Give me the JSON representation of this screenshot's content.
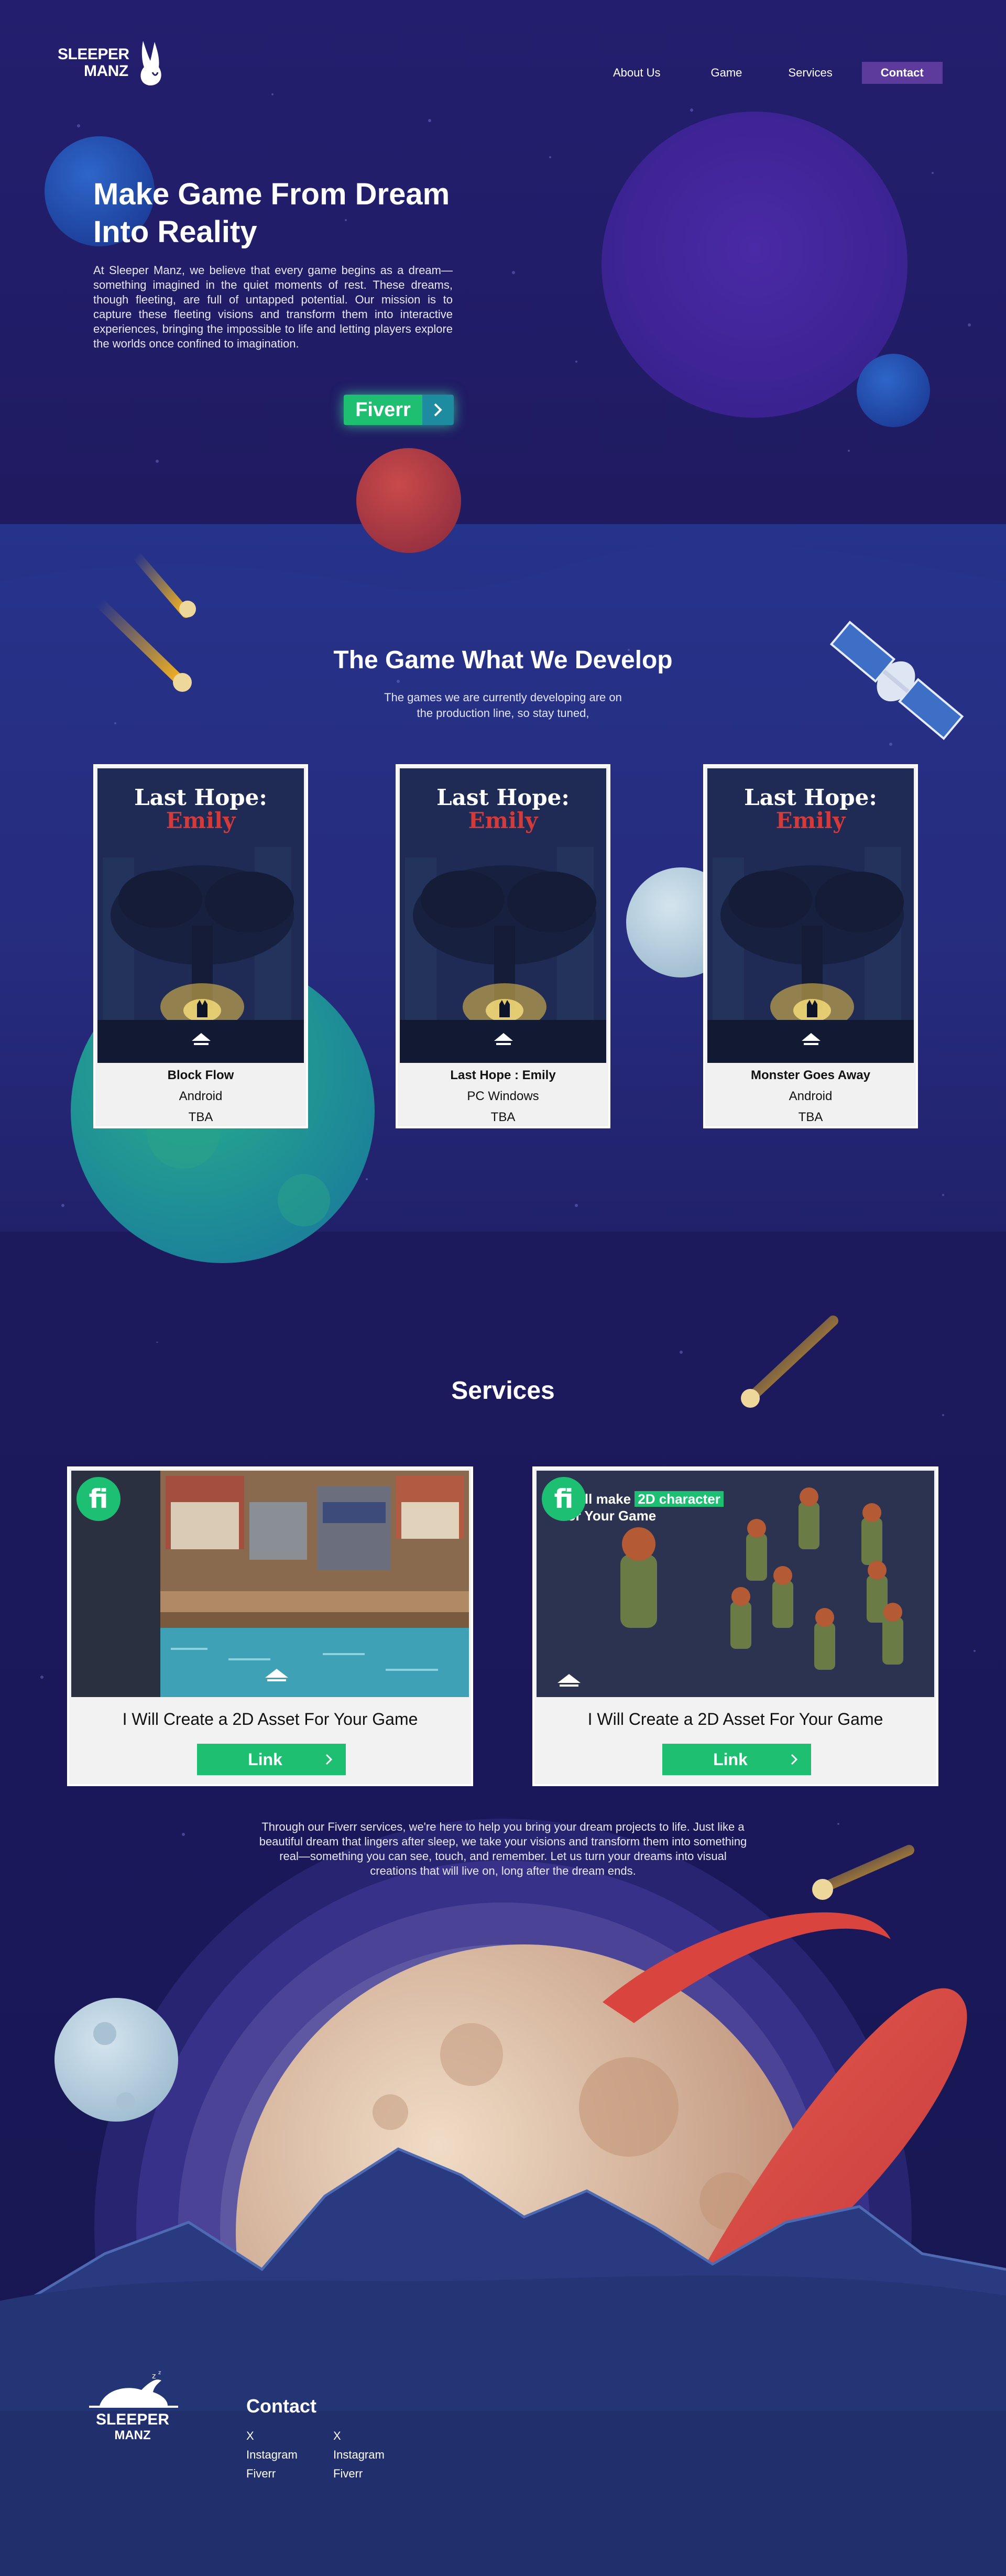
{
  "nav": {
    "logo_line1": "SLEEPER",
    "logo_line2": "MANZ",
    "items": [
      {
        "label": "About Us"
      },
      {
        "label": "Game"
      },
      {
        "label": "Services"
      },
      {
        "label": "Contact"
      }
    ]
  },
  "hero": {
    "title": "Make Game From Dream Into Reality",
    "description": "At Sleeper Manz, we believe that every game begins as a dream—something imagined in the quiet moments of rest. These dreams, though fleeting, are full of untapped potential. Our mission is to capture these fleeting visions and transform them into interactive experiences, bringing the impossible to life and letting players explore the worlds once confined to imagination.",
    "cta_label": "Fiverr"
  },
  "games": {
    "title": "The Game What We Develop",
    "subtitle_line1": "The games we are currently developing are on",
    "subtitle_line2": "the production line, so stay tuned,",
    "art_title_line1": "Last Hope:",
    "art_title_line2": "Emily",
    "items": [
      {
        "name": "Block Flow",
        "platform": "Android",
        "release": "TBA"
      },
      {
        "name": "Last Hope : Emily",
        "platform": "PC Windows",
        "release": "TBA"
      },
      {
        "name": "Monster Goes Away",
        "platform": "Android",
        "release": "TBA"
      }
    ]
  },
  "services": {
    "title": "Services",
    "items": [
      {
        "title": "I Will Create a 2D Asset For Your Game",
        "button": "Link",
        "banner_text": ""
      },
      {
        "title": "I Will Create a 2D Asset For Your Game",
        "button": "Link",
        "banner_line1": "I will make",
        "banner_highlight": "2D character",
        "banner_line2": "for Your Game"
      }
    ],
    "description": "Through our Fiverr services, we're here to help you bring your dream projects to life. Just like a beautiful dream that lingers after sleep, we take your visions and transform them into something real—something you can see, touch, and remember. Let us turn your dreams into visual creations that will live on, long after the dream ends."
  },
  "footer": {
    "logo_line1": "SLEEPER",
    "logo_line2": "MANZ",
    "contact_title": "Contact",
    "col1": [
      "X",
      "Instagram",
      "Fiverr"
    ],
    "col2": [
      "X",
      "Instagram",
      "Fiverr"
    ]
  },
  "colors": {
    "accent_green": "#1fbf72",
    "contact_purple": "#5c3b9d",
    "background": "#1f1a5e"
  }
}
